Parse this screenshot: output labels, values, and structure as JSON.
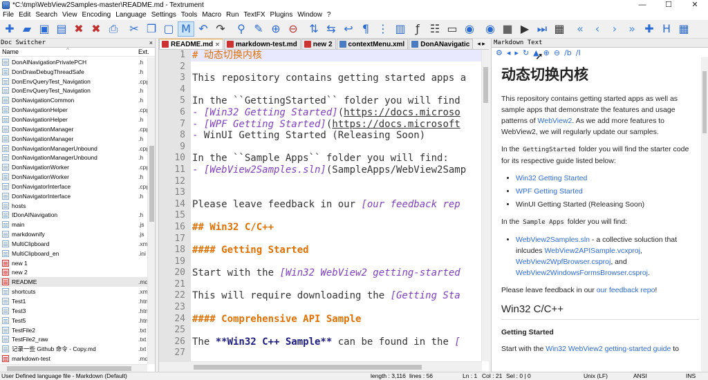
{
  "window": {
    "title": "*C:\\tmp\\WebView2Samples-master\\README.md - Textrument",
    "min": "—",
    "max": "☐",
    "close": "✕"
  },
  "menu": [
    "File",
    "Edit",
    "Search",
    "View",
    "Encoding",
    "Language",
    "Settings",
    "Tools",
    "Macro",
    "Run",
    "TextFX",
    "Plugins",
    "Window",
    "?"
  ],
  "toolbar": [
    {
      "name": "new-file-icon",
      "glyph": "✚",
      "color": "#2a6ad4"
    },
    {
      "name": "open-folder-icon",
      "glyph": "▰",
      "color": "#2a6ad4"
    },
    {
      "name": "save-icon",
      "glyph": "▣",
      "color": "#2a6ad4"
    },
    {
      "name": "save-all-icon",
      "glyph": "▤",
      "color": "#2a6ad4"
    },
    {
      "name": "close-icon",
      "glyph": "✖",
      "color": "#c03030"
    },
    {
      "name": "close-all-icon",
      "glyph": "✖",
      "color": "#c03030"
    },
    {
      "name": "print-icon",
      "glyph": "⎙",
      "color": "#2a6ad4"
    },
    {
      "sep": true
    },
    {
      "name": "cut-icon",
      "glyph": "✂",
      "color": "#2a6ad4"
    },
    {
      "name": "copy-icon",
      "glyph": "❐",
      "color": "#2a6ad4"
    },
    {
      "name": "paste-icon",
      "glyph": "▢",
      "color": "#2a6ad4"
    },
    {
      "name": "markdown-icon",
      "glyph": "M",
      "color": "#2a6ad4",
      "sel": true
    },
    {
      "name": "undo-icon",
      "glyph": "↶",
      "color": "#2a6ad4"
    },
    {
      "name": "redo-icon",
      "glyph": "↷",
      "color": "#333"
    },
    {
      "sep": true
    },
    {
      "name": "find-icon",
      "glyph": "⚲",
      "color": "#2a6ad4"
    },
    {
      "name": "replace-icon",
      "glyph": "✎",
      "color": "#2a6ad4"
    },
    {
      "name": "zoom-in-icon",
      "glyph": "⊕",
      "color": "#2a6ad4"
    },
    {
      "name": "zoom-out-icon",
      "glyph": "⊖",
      "color": "#c03030"
    },
    {
      "sep": true
    },
    {
      "name": "sync-vertical-icon",
      "glyph": "⇅",
      "color": "#2a6ad4"
    },
    {
      "name": "sync-horizontal-icon",
      "glyph": "⇆",
      "color": "#2a6ad4"
    },
    {
      "name": "word-wrap-icon",
      "glyph": "↩",
      "color": "#2a6ad4"
    },
    {
      "name": "show-all-chars-icon",
      "glyph": "¶",
      "color": "#2a6ad4"
    },
    {
      "name": "indent-guide-icon",
      "glyph": "⋮",
      "color": "#2a6ad4"
    },
    {
      "name": "doc-map-icon",
      "glyph": "▥",
      "color": "#2a6ad4"
    },
    {
      "name": "function-list-icon",
      "glyph": "ƒ",
      "color": "#333"
    },
    {
      "name": "folder-workspace-icon",
      "glyph": "☷",
      "color": "#333"
    },
    {
      "name": "monitor-icon",
      "glyph": "▭",
      "color": "#333"
    },
    {
      "name": "eye-icon",
      "glyph": "◉",
      "color": "#2a6ad4"
    },
    {
      "sep": true
    },
    {
      "name": "record-macro-icon",
      "glyph": "◉",
      "color": "#2a6ad4"
    },
    {
      "name": "stop-macro-icon",
      "glyph": "■",
      "color": "#666"
    },
    {
      "name": "play-macro-icon",
      "glyph": "▶",
      "color": "#333"
    },
    {
      "name": "run-macro-multiple-icon",
      "glyph": "⏭",
      "color": "#2a6ad4"
    },
    {
      "name": "save-macro-icon",
      "glyph": "▦",
      "color": "#333"
    },
    {
      "sep": true
    },
    {
      "name": "first-icon",
      "glyph": "«",
      "color": "#4a8ae0"
    },
    {
      "name": "previous-icon",
      "glyph": "‹",
      "color": "#4a8ae0"
    },
    {
      "name": "next-icon",
      "glyph": "›",
      "color": "#4a8ae0"
    },
    {
      "name": "last-icon",
      "glyph": "»",
      "color": "#4a8ae0"
    },
    {
      "name": "plugin-icon",
      "glyph": "✚",
      "color": "#2a6ad4"
    },
    {
      "name": "heading-icon",
      "glyph": "H",
      "color": "#2a6ad4"
    },
    {
      "name": "table-icon",
      "glyph": "▦",
      "color": "#2a6ad4"
    }
  ],
  "doc_switcher": {
    "title": "Doc Switcher",
    "close": "×",
    "col_name": "Name",
    "col_ext": "Ext.",
    "sort": "^",
    "files": [
      {
        "name": "DonAINavigationPrivatePCH",
        "ext": ".h"
      },
      {
        "name": "DonDrawDebugThreadSafe",
        "ext": ".h"
      },
      {
        "name": "DonEnvQueryTest_Navigation",
        "ext": ".cpp"
      },
      {
        "name": "DonEnvQueryTest_Navigation",
        "ext": ".h"
      },
      {
        "name": "DonNavigationCommon",
        "ext": ".h"
      },
      {
        "name": "DonNavigationHelper",
        "ext": ".cpp"
      },
      {
        "name": "DonNavigationHelper",
        "ext": ".h"
      },
      {
        "name": "DonNavigationManager",
        "ext": ".cpp"
      },
      {
        "name": "DonNavigationManager",
        "ext": ".h"
      },
      {
        "name": "DonNavigationManagerUnbound",
        "ext": ".cpp"
      },
      {
        "name": "DonNavigationManagerUnbound",
        "ext": ".h"
      },
      {
        "name": "DonNavigationWorker",
        "ext": ".cpp"
      },
      {
        "name": "DonNavigationWorker",
        "ext": ".h"
      },
      {
        "name": "DonNavigatorInterface",
        "ext": ".cpp"
      },
      {
        "name": "DonNavigatorInterface",
        "ext": ".h"
      },
      {
        "name": "hosts",
        "ext": ""
      },
      {
        "name": "IDonAINavigation",
        "ext": ".h"
      },
      {
        "name": "main",
        "ext": ".js"
      },
      {
        "name": "markdownify",
        "ext": ".js"
      },
      {
        "name": "MultiClipboard",
        "ext": ".xml"
      },
      {
        "name": "MultiClipboard_en",
        "ext": ".ini"
      },
      {
        "name": "new 1",
        "ext": "",
        "red": true
      },
      {
        "name": "new 2",
        "ext": "",
        "red": true
      },
      {
        "name": "README",
        "ext": ".md",
        "red": true,
        "sel": true
      },
      {
        "name": "shortcuts",
        "ext": ".xml"
      },
      {
        "name": "Test1",
        "ext": ".html"
      },
      {
        "name": "Test3",
        "ext": ".html"
      },
      {
        "name": "Test5",
        "ext": ".html"
      },
      {
        "name": "TestFile2",
        "ext": ".txt"
      },
      {
        "name": "TestFile2_raw",
        "ext": ".txt"
      },
      {
        "name": "记录一些 Github 命令 - Copy.md",
        "ext": ".txt"
      },
      {
        "name": "markdown-test",
        "ext": ".md",
        "red": true
      }
    ]
  },
  "tabs": [
    {
      "label": "README.md",
      "active": true,
      "red": true
    },
    {
      "label": "markdown-test.md",
      "red": true
    },
    {
      "label": "new 2",
      "red": true
    },
    {
      "label": "contextMenu.xml"
    },
    {
      "label": "DonANavigatic"
    }
  ],
  "tabnav": "◂ ▸",
  "editor_lines": [
    {
      "n": "1",
      "cur": true,
      "parts": [
        {
          "c": "c-h1",
          "t": "# 动态切换内核"
        }
      ]
    },
    {
      "n": "2",
      "parts": []
    },
    {
      "n": "3",
      "parts": [
        {
          "t": "This repository contains getting started apps a"
        }
      ]
    },
    {
      "n": "4",
      "parts": []
    },
    {
      "n": "5",
      "parts": [
        {
          "t": "In the ``GettingStarted`` folder you will find"
        }
      ]
    },
    {
      "n": "6",
      "parts": [
        {
          "c": "c-li",
          "t": "- "
        },
        {
          "c": "c-link",
          "t": "[Win32 Getting Started]"
        },
        {
          "t": "("
        },
        {
          "c": "c-url",
          "t": "https://docs.microso"
        }
      ]
    },
    {
      "n": "7",
      "parts": [
        {
          "c": "c-li",
          "t": "- "
        },
        {
          "c": "c-link",
          "t": "[WPF Getting Started]"
        },
        {
          "t": "("
        },
        {
          "c": "c-url",
          "t": "https://docs.microsoft"
        }
      ]
    },
    {
      "n": "8",
      "parts": [
        {
          "c": "c-li",
          "t": "- "
        },
        {
          "t": "WinUI Getting Started (Releasing Soon)"
        }
      ]
    },
    {
      "n": "9",
      "parts": []
    },
    {
      "n": "10",
      "parts": [
        {
          "t": "In the ``Sample Apps`` folder you will find:"
        }
      ]
    },
    {
      "n": "11",
      "parts": [
        {
          "c": "c-li",
          "t": "- "
        },
        {
          "c": "c-link",
          "t": "[WebView2Samples.sln]"
        },
        {
          "t": "(SampleApps/WebView2Samp"
        }
      ]
    },
    {
      "n": "12",
      "parts": []
    },
    {
      "n": "13",
      "parts": []
    },
    {
      "n": "14",
      "parts": [
        {
          "t": "Please leave feedback in our "
        },
        {
          "c": "c-link",
          "t": "[our feedback rep"
        }
      ]
    },
    {
      "n": "15",
      "parts": []
    },
    {
      "n": "16",
      "parts": [
        {
          "c": "c-h",
          "t": "## Win32 C/C++"
        }
      ]
    },
    {
      "n": "17",
      "parts": []
    },
    {
      "n": "18",
      "parts": [
        {
          "c": "c-h",
          "t": "#### Getting Started"
        }
      ]
    },
    {
      "n": "19",
      "parts": []
    },
    {
      "n": "20",
      "parts": [
        {
          "t": "Start with the "
        },
        {
          "c": "c-link",
          "t": "[Win32 WebView2 getting-started"
        }
      ]
    },
    {
      "n": "21",
      "parts": []
    },
    {
      "n": "22",
      "parts": [
        {
          "t": "This will require downloading the "
        },
        {
          "c": "c-link",
          "t": "[Getting Sta"
        }
      ]
    },
    {
      "n": "23",
      "parts": []
    },
    {
      "n": "24",
      "parts": [
        {
          "c": "c-h",
          "t": "#### Comprehensive API Sample"
        }
      ]
    },
    {
      "n": "25",
      "parts": []
    },
    {
      "n": "26",
      "parts": [
        {
          "t": "The "
        },
        {
          "c": "c-b",
          "t": "**Win32 C++ Sample**"
        },
        {
          "t": " can be found in the "
        },
        {
          "c": "c-link",
          "t": "["
        }
      ]
    },
    {
      "n": "27",
      "parts": []
    }
  ],
  "preview": {
    "title": "Markdown Text",
    "tools": [
      "⚙",
      "◂",
      "▸",
      "↻",
      "▲",
      "⊕",
      "⊖",
      "/b",
      "/I"
    ],
    "h1": "动态切换内核",
    "p1": "This repository contains getting started apps as well as sample apps that demonstrate the features and usage patterns of ",
    "p1_link": "WebView2",
    "p1_end": ". As we add more features to WebView2, we will regularly update our samples.",
    "p2_a": "In the ",
    "p2_code": "GettingStarted",
    "p2_b": " folder you will find the starter code for its respective guide listed below:",
    "list1": [
      "Win32 Getting Started",
      "WPF Getting Started"
    ],
    "list1_plain": "WinUI Getting Started (Releasing Soon)",
    "p3_a": "In the ",
    "p3_code": "Sample Apps",
    "p3_b": " folder you will find:",
    "li4_link": "WebView2Samples.sln",
    "li4_text": " - a collective soluction that inlcudes ",
    "li4_l2": "WebView2APISample.vcxproj",
    "li4_comma": ", ",
    "li4_l3": "WebView2WpfBrowser.csproj",
    "li4_and": ", and ",
    "li4_l4": "WebView2WindowsFormsBrowser.csproj",
    "li4_end": ".",
    "p4": "Please leave feedback in our ",
    "p4_link": "our feedback repo",
    "p4_end": "!",
    "h2": "Win32 C/C++",
    "h4": "Getting Started",
    "p5": "Start with the ",
    "p5_link": "Win32 WebView2 getting-started guide",
    "p5_end": " to"
  },
  "status": {
    "lang": "User Defined language file - Markdown (Default)",
    "length": "length : 3,116",
    "lines": "lines : 56",
    "ln": "Ln : 1",
    "col": "Col : 21",
    "sel": "Sel : 0 | 0",
    "eol": "Unix (LF)",
    "enc": "ANSI",
    "mode": "INS"
  }
}
